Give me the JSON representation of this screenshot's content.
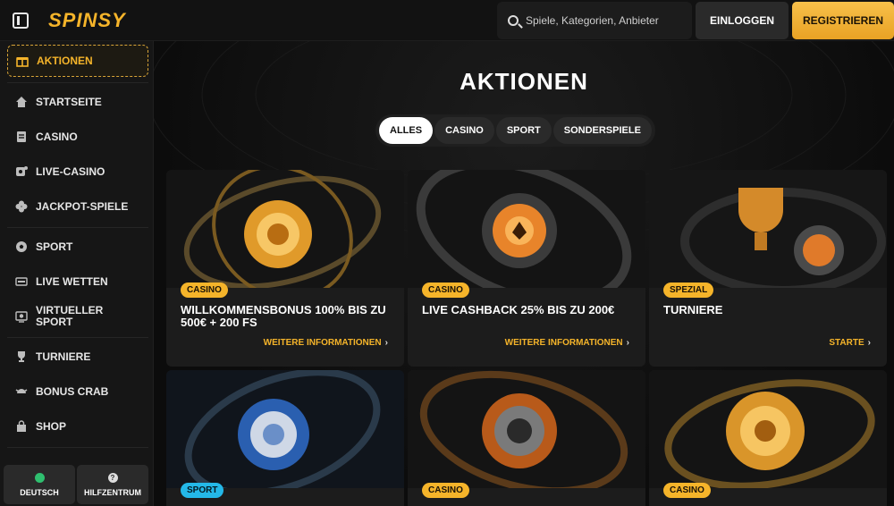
{
  "header": {
    "logo": "SPINSY",
    "search_placeholder": "Spiele, Kategorien, Anbieter",
    "login_label": "EINLOGGEN",
    "register_label": "REGISTRIEREN"
  },
  "sidebar": {
    "items": [
      {
        "label": "AKTIONEN",
        "icon": "gift-icon"
      },
      {
        "label": "STARTSEITE",
        "icon": "home-icon"
      },
      {
        "label": "CASINO",
        "icon": "casino-icon"
      },
      {
        "label": "LIVE-CASINO",
        "icon": "live-casino-icon"
      },
      {
        "label": "JACKPOT-SPIELE",
        "icon": "clover-icon"
      },
      {
        "label": "SPORT",
        "icon": "soccer-icon"
      },
      {
        "label": "LIVE WETTEN",
        "icon": "live-icon"
      },
      {
        "label": "VIRTUELLER SPORT",
        "icon": "virtual-sport-icon"
      },
      {
        "label": "TURNIERE",
        "icon": "trophy-icon"
      },
      {
        "label": "BONUS CRAB",
        "icon": "crab-icon"
      },
      {
        "label": "SHOP",
        "icon": "shop-icon"
      }
    ],
    "language_label": "DEUTSCH",
    "help_label": "HILFZENTRUM"
  },
  "main": {
    "title": "AKTIONEN",
    "filters": [
      "ALLES",
      "CASINO",
      "SPORT",
      "SONDERSPIELE"
    ],
    "active_filter": "ALLES",
    "cards": [
      {
        "badge": "CASINO",
        "title": "WILLKOMMENSBONUS 100% BIS ZU 500€ + 200 FS",
        "link": "WEITERE INFORMATIONEN"
      },
      {
        "badge": "CASINO",
        "title": "LIVE CASHBACK 25% BIS ZU 200€",
        "link": "WEITERE INFORMATIONEN"
      },
      {
        "badge": "SPEZIAL",
        "title": "TURNIERE",
        "link": "STARTE"
      },
      {
        "badge": "SPORT",
        "title": "",
        "link": ""
      },
      {
        "badge": "CASINO",
        "title": "",
        "link": ""
      },
      {
        "badge": "CASINO",
        "title": "",
        "link": ""
      }
    ]
  },
  "colors": {
    "accent": "#f5b42a",
    "sport_badge": "#24b8e8",
    "background": "#0f0f0f"
  }
}
